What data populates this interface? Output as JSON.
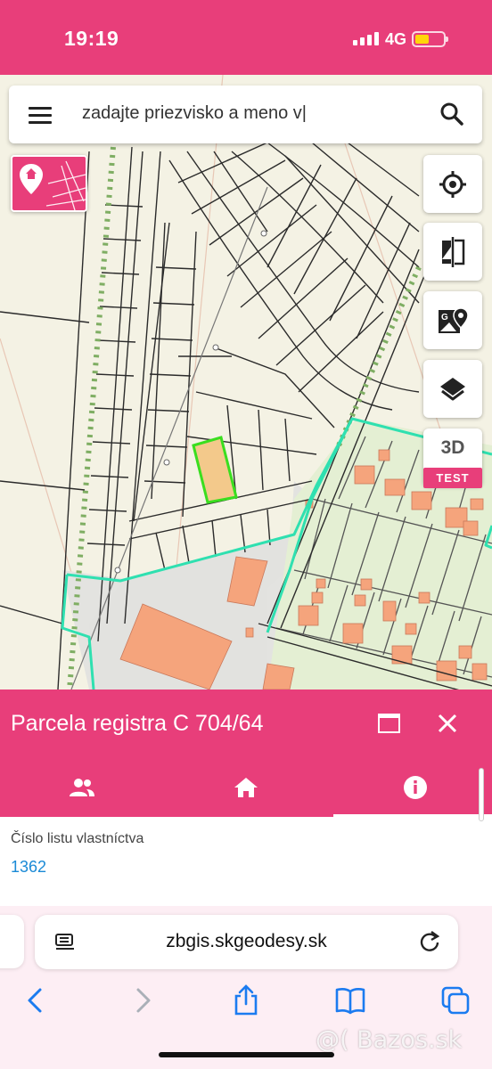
{
  "status_bar": {
    "time": "19:19",
    "network": "4G"
  },
  "search": {
    "placeholder": "zadajte priezvisko a meno v|"
  },
  "map_controls": {
    "btn_3d_label": "3D",
    "btn_3d_badge": "TEST"
  },
  "parcel_panel": {
    "title": "Parcela registra C 704/64",
    "field_label": "Číslo listu vlastníctva",
    "field_value": "1362"
  },
  "browser": {
    "url": "zbgis.skgeodesy.sk"
  },
  "watermark": "@( Bazos.sk",
  "colors": {
    "accent": "#e83e7a",
    "selected_parcel": "#f3c98b",
    "building": "#f5a47c",
    "link": "#1a8ad6"
  }
}
